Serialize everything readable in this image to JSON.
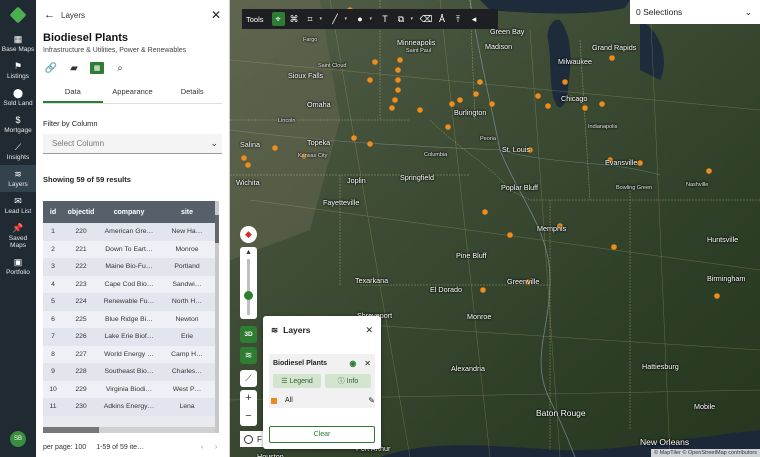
{
  "rail": {
    "items": [
      {
        "icon": "map-icon",
        "glyph": "▦",
        "label": "Base Maps"
      },
      {
        "icon": "flag-icon",
        "glyph": "⚑",
        "label": "Listings"
      },
      {
        "icon": "pin-icon",
        "glyph": "⬤",
        "label": "Sold Land"
      },
      {
        "icon": "dollar-icon",
        "glyph": "$",
        "label": "Mortgage"
      },
      {
        "icon": "trend-icon",
        "glyph": "⟋",
        "label": "Insights"
      },
      {
        "icon": "layers-icon",
        "glyph": "≋",
        "label": "Layers"
      },
      {
        "icon": "mail-icon",
        "glyph": "✉",
        "label": "Lead List"
      },
      {
        "icon": "pushpin-icon",
        "glyph": "📌",
        "label": "Saved Maps"
      },
      {
        "icon": "briefcase-icon",
        "glyph": "▣",
        "label": "Portfolio"
      }
    ],
    "avatar": "SB"
  },
  "panel": {
    "back_label": "Layers",
    "layer_title": "Biodiesel Plants",
    "layer_subtitle": "Infrastructure & Utilities, Power & Renewables",
    "tabs": [
      "Data",
      "Appearance",
      "Details"
    ],
    "filter_label": "Filter by Column",
    "select_placeholder": "Select Column",
    "showing_text": "Showing 59 of 59 results",
    "table": {
      "headers": [
        "id",
        "objectid",
        "company",
        "site"
      ],
      "rows": [
        [
          "1",
          "220",
          "American Gre…",
          "New Ha…"
        ],
        [
          "2",
          "221",
          "Down To Eart…",
          "Monroe"
        ],
        [
          "3",
          "222",
          "Maine Bio-Fu…",
          "Portland"
        ],
        [
          "4",
          "223",
          "Cape Cod Bio…",
          "Sandwi…"
        ],
        [
          "5",
          "224",
          "Renewable Fu…",
          "North H…"
        ],
        [
          "6",
          "225",
          "Blue Ridge Bi…",
          "Newton"
        ],
        [
          "7",
          "226",
          "Lake Erie Biof…",
          "Erie"
        ],
        [
          "8",
          "227",
          "World Energy …",
          "Camp H…"
        ],
        [
          "9",
          "228",
          "Southeast Bio…",
          "Charles…"
        ],
        [
          "10",
          "229",
          "Virginia Biodi…",
          "West P…"
        ],
        [
          "11",
          "230",
          "Adkins Energy…",
          "Lena"
        ]
      ]
    },
    "footer": {
      "per_page": "per page: 100",
      "range": "1-59 of 59 ite…",
      "prev": "‹",
      "next": "›"
    }
  },
  "toolbar": {
    "label": "Tools"
  },
  "selections": {
    "label": "0 Selections"
  },
  "map_controls": {
    "btn3d": "3D"
  },
  "layers_popup": {
    "title": "Layers",
    "layer_name": "Biodiesel Plants",
    "legend_label": "Legend",
    "info_label": "Info",
    "category_label": "All",
    "clear_label": "Clear",
    "swatch_color": "#e88b1e"
  },
  "draw_toggle_label": "F",
  "attribution": "© MapTiler © OpenStreetMap contributors",
  "map": {
    "cities": [
      {
        "name": "Fargo",
        "cls": "small"
      },
      {
        "name": "Saint Cloud",
        "cls": "small"
      },
      {
        "name": "Minneapolis",
        "cls": ""
      },
      {
        "name": "Saint Paul",
        "cls": "small"
      },
      {
        "name": "Green Bay",
        "cls": ""
      },
      {
        "name": "Sioux Falls",
        "cls": ""
      },
      {
        "name": "Madison",
        "cls": ""
      },
      {
        "name": "Milwaukee",
        "cls": ""
      },
      {
        "name": "Grand Rapids",
        "cls": ""
      },
      {
        "name": "Omaha",
        "cls": ""
      },
      {
        "name": "Lincoln",
        "cls": "small"
      },
      {
        "name": "Burlington",
        "cls": ""
      },
      {
        "name": "Chicago",
        "cls": ""
      },
      {
        "name": "Peoria",
        "cls": "small"
      },
      {
        "name": "Indianapolis",
        "cls": "small"
      },
      {
        "name": "Salina",
        "cls": ""
      },
      {
        "name": "Topeka",
        "cls": ""
      },
      {
        "name": "Kansas City",
        "cls": "small"
      },
      {
        "name": "Columbia",
        "cls": "small"
      },
      {
        "name": "St. Louis",
        "cls": ""
      },
      {
        "name": "Wichita",
        "cls": ""
      },
      {
        "name": "Joplin",
        "cls": ""
      },
      {
        "name": "Springfield",
        "cls": ""
      },
      {
        "name": "Evansville",
        "cls": ""
      },
      {
        "name": "Poplar Bluff",
        "cls": ""
      },
      {
        "name": "Bowling Green",
        "cls": "small"
      },
      {
        "name": "Nashville",
        "cls": "small"
      },
      {
        "name": "Fayetteville",
        "cls": ""
      },
      {
        "name": "Memphis",
        "cls": ""
      },
      {
        "name": "Huntsville",
        "cls": ""
      },
      {
        "name": "Pine Bluff",
        "cls": ""
      },
      {
        "name": "Texarkana",
        "cls": ""
      },
      {
        "name": "El Dorado",
        "cls": ""
      },
      {
        "name": "Greenville",
        "cls": ""
      },
      {
        "name": "Birmingham",
        "cls": ""
      },
      {
        "name": "Shreveport",
        "cls": ""
      },
      {
        "name": "Monroe",
        "cls": ""
      },
      {
        "name": "Hattiesburg",
        "cls": ""
      },
      {
        "name": "Alexandria",
        "cls": ""
      },
      {
        "name": "Baton Rouge",
        "cls": "big"
      },
      {
        "name": "Mobile",
        "cls": ""
      },
      {
        "name": "New Orleans",
        "cls": "big"
      },
      {
        "name": "Port Arthur",
        "cls": ""
      },
      {
        "name": "Houston",
        "cls": ""
      }
    ],
    "marker_color": "#f08c1a"
  }
}
